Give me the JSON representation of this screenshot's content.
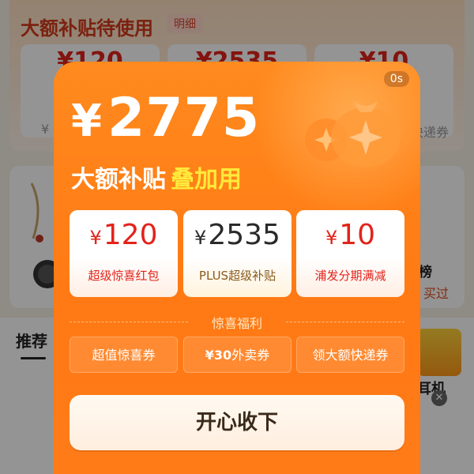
{
  "background": {
    "header_title": "大额补贴待使用",
    "detail_tag": "明细",
    "cards": [
      {
        "amount": "¥120",
        "sub": "¥"
      },
      {
        "amount": "¥2535",
        "sub": ""
      },
      {
        "amount": "¥10",
        "sub": "快递券"
      }
    ],
    "recommend_tab": "推荐",
    "rank_label": "榜",
    "buy_label": "买过",
    "earphone_label": "耳机"
  },
  "modal": {
    "timer": "0s",
    "total": {
      "currency": "¥",
      "value": "2775"
    },
    "headline_main": "大额补贴",
    "headline_highlight": "叠加用",
    "coupons": [
      {
        "currency": "¥",
        "amount": "120",
        "label": "超级惊喜红包"
      },
      {
        "currency": "¥",
        "amount": "2535",
        "label": "PLUS超级补贴"
      },
      {
        "currency": "¥",
        "amount": "10",
        "label": "浦发分期满减"
      }
    ],
    "section_title": "惊喜福利",
    "benefits": [
      {
        "label": "超值惊喜券"
      },
      {
        "bold": "¥30",
        "label": "外卖券"
      },
      {
        "label": "领大额快递券"
      }
    ],
    "cta_label": "开心收下"
  },
  "colors": {
    "modal_orange": "#ff7a14",
    "highlight_yellow": "#ffe93a",
    "coupon_red": "#e2231a"
  }
}
